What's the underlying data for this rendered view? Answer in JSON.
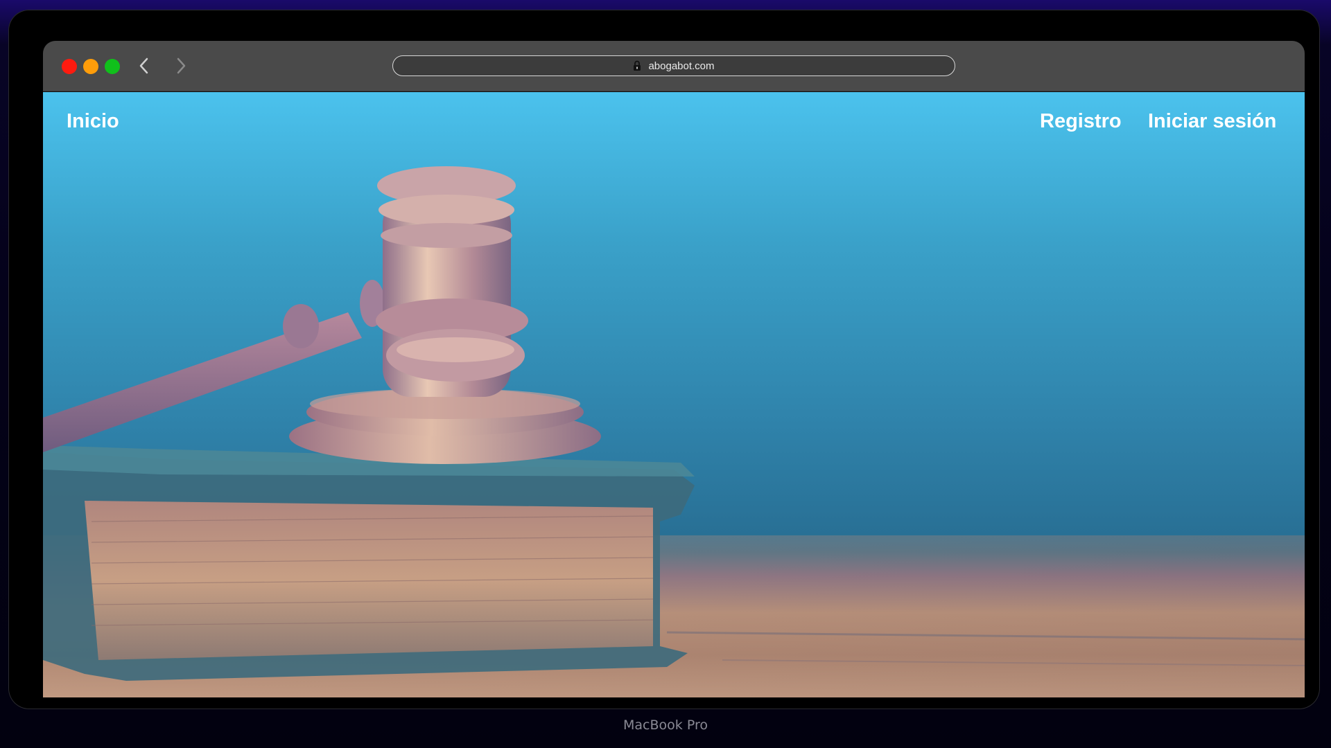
{
  "browser": {
    "url": "abogabot.com"
  },
  "nav": {
    "home": "Inicio",
    "register": "Registro",
    "login": "Iniciar sesión"
  },
  "device": {
    "label": "MacBook Pro"
  },
  "icons": {
    "lock": "lock-icon",
    "back": "chevron-left-icon",
    "forward": "chevron-right-icon",
    "hero": "gavel-and-book-illustration"
  },
  "colors": {
    "close": "#fe1b0f",
    "minimize": "#fe9d0a",
    "maximize": "#10c01b",
    "sky_top": "#4bc2ed",
    "wood": "#b69078"
  }
}
